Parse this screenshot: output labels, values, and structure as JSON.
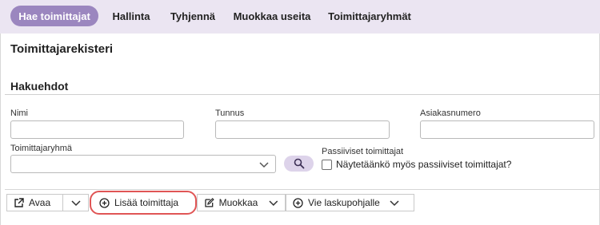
{
  "nav": {
    "tabs": [
      {
        "label": "Hae toimittajat",
        "active": true
      },
      {
        "label": "Hallinta"
      },
      {
        "label": "Tyhjennä"
      },
      {
        "label": "Muokkaa useita"
      },
      {
        "label": "Toimittajaryhmät"
      }
    ]
  },
  "page": {
    "title": "Toimittajarekisteri",
    "section": "Hakuehdot"
  },
  "form": {
    "name_label": "Nimi",
    "name_value": "",
    "id_label": "Tunnus",
    "id_value": "",
    "customer_number_label": "Asiakasnumero",
    "customer_number_value": "",
    "group_label": "Toimittajaryhmä",
    "group_value": "",
    "passive_label": "Passiiviset toimittajat",
    "passive_checkbox_label": "Näytetäänkö myös passiiviset toimittajat?",
    "passive_checked": false
  },
  "toolbar": {
    "open_label": "Avaa",
    "add_label": "Lisää toimittaja",
    "edit_label": "Muokkaa",
    "export_label": "Vie laskupohjalle"
  },
  "colors": {
    "nav_bg": "#ebe5f2",
    "active_tab": "#9b86bf",
    "search_button": "#ddd3ea",
    "highlight": "#e05555"
  }
}
